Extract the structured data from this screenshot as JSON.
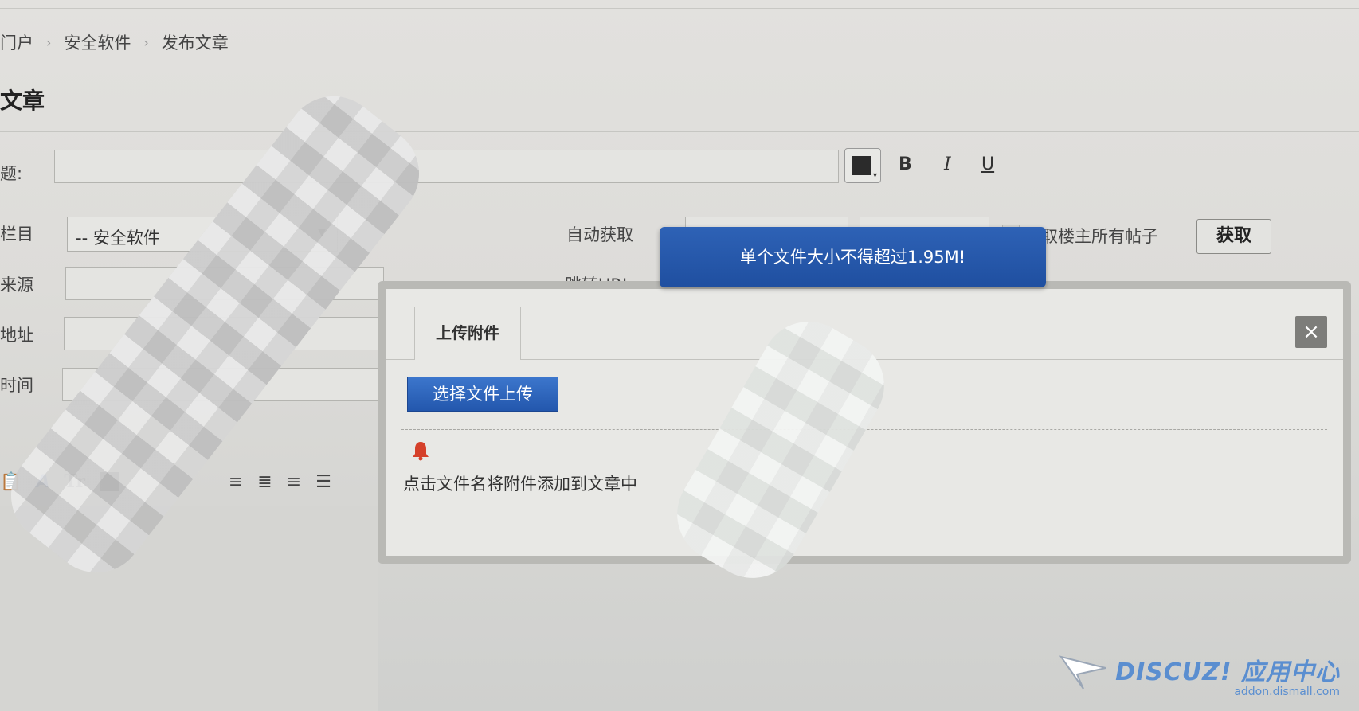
{
  "breadcrumb": [
    "门户",
    "安全软件",
    "发布文章"
  ],
  "breadcrumb_separator": "›",
  "page_title": "文章",
  "form": {
    "title_label": "题:",
    "column_label": "栏目",
    "column_value": "-- 安全软件",
    "source_label": "来源",
    "address_label": "地址",
    "time_label": "时间",
    "auto_fetch_label": "自动获取",
    "jump_url_label": "跳转URL",
    "fetch_all_posts_label": "获取楼主所有帖子",
    "fetch_button": "获取",
    "bold_label": "B",
    "italic_label": "I",
    "underline_label": "U"
  },
  "toast": {
    "message": "单个文件大小不得超过1.95M!"
  },
  "dialog": {
    "tab_label": "上传附件",
    "close_label": "×",
    "upload_button": "选择文件上传",
    "hint": "点击文件名将附件添加到文章中"
  },
  "toolbar": {
    "font_color_label": "A",
    "font_size_label": "Tr"
  },
  "watermark": {
    "logo": "DISCUZ! 应用中心",
    "sub": "addon.dismall.com"
  },
  "colors": {
    "toast_bg": "#2558ab",
    "upload_button_bg": "#2f66bd",
    "watermark": "#5a8ed0",
    "bell": "#d5402a"
  }
}
